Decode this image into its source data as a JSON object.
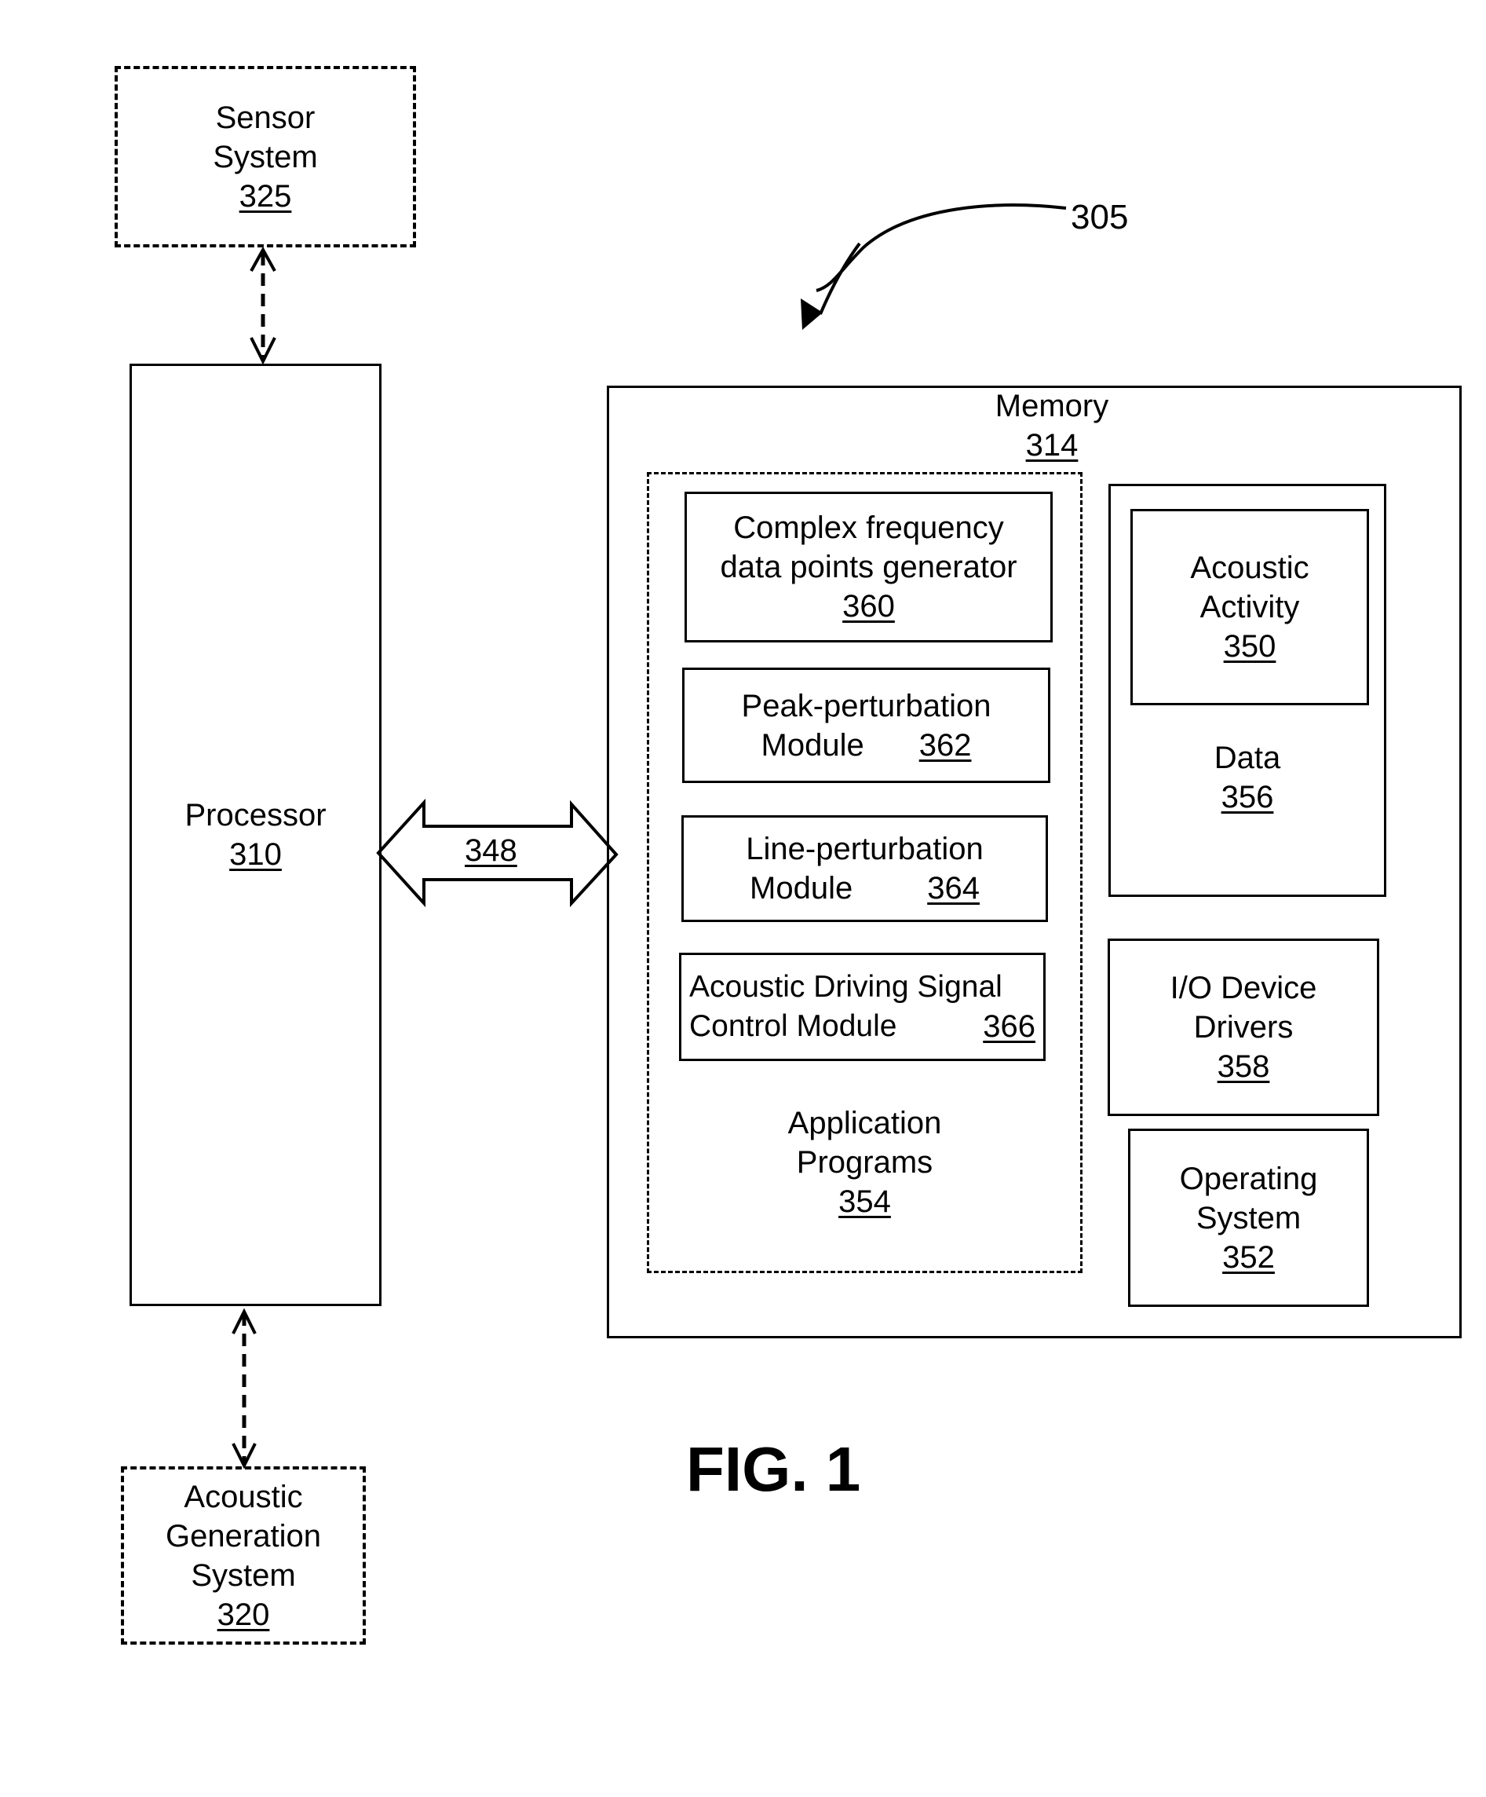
{
  "figure": {
    "caption": "FIG. 1",
    "system_ref": "305"
  },
  "sensor_system": {
    "line1": "Sensor",
    "line2": "System",
    "ref": "325"
  },
  "processor": {
    "label": "Processor",
    "ref": "310"
  },
  "acoustic_generation_system": {
    "line1": "Acoustic",
    "line2": "Generation",
    "line3": "System",
    "ref": "320"
  },
  "bus": {
    "ref": "348"
  },
  "memory": {
    "label": "Memory",
    "ref": "314",
    "application_programs": {
      "line1": "Application",
      "line2": "Programs",
      "ref": "354",
      "modules": [
        {
          "line1": "Complex frequency",
          "line2": "data points generator",
          "ref": "360"
        },
        {
          "line1": "Peak-perturbation",
          "line2": "Module",
          "ref": "362"
        },
        {
          "line1": "Line-perturbation",
          "line2": "Module",
          "ref": "364"
        },
        {
          "line1": "Acoustic Driving Signal",
          "line2": "Control Module",
          "ref": "366"
        }
      ]
    },
    "data": {
      "label": "Data",
      "ref": "356",
      "acoustic_activity": {
        "line1": "Acoustic",
        "line2": "Activity",
        "ref": "350"
      }
    },
    "io_device_drivers": {
      "line1": "I/O Device",
      "line2": "Drivers",
      "ref": "358"
    },
    "operating_system": {
      "line1": "Operating",
      "line2": "System",
      "ref": "352"
    }
  }
}
